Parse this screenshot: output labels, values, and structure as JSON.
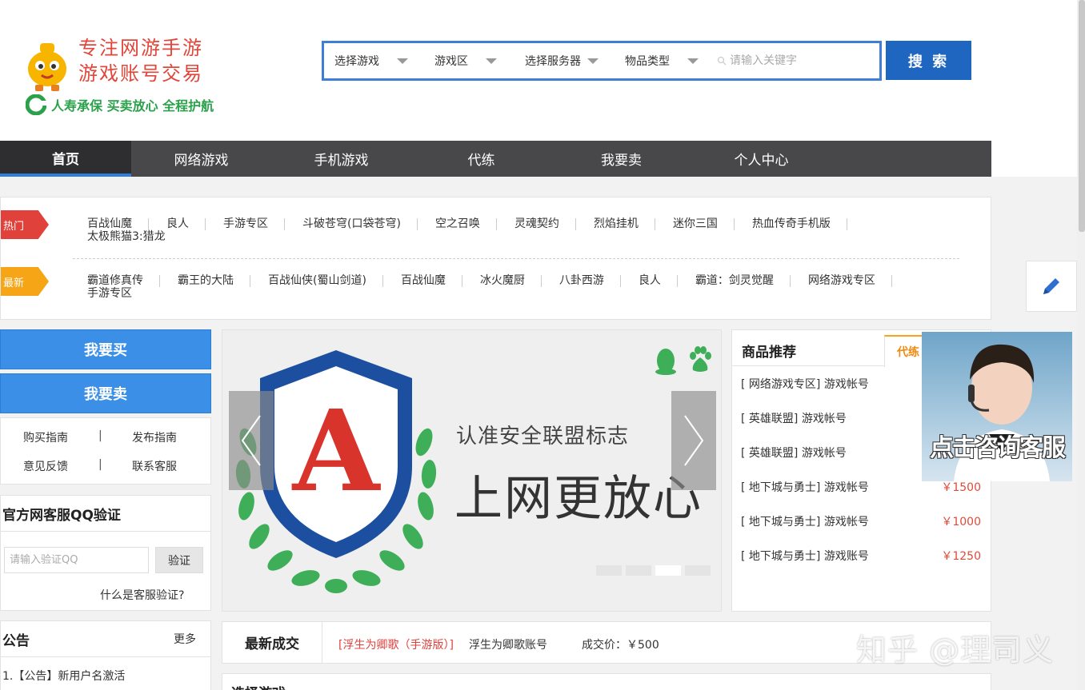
{
  "header": {
    "slogan_line1": "专注网游手游",
    "slogan_line2": "游戏账号交易",
    "promise": "人寿承保  买卖放心  全程护航"
  },
  "search": {
    "select_game": "选择游戏",
    "select_zone": "游戏区",
    "select_server": "选择服务器",
    "select_item_type": "物品类型",
    "keyword_placeholder": "请输入关键字",
    "button": "搜 索"
  },
  "nav": {
    "items": [
      {
        "label": "首页"
      },
      {
        "label": "网络游戏"
      },
      {
        "label": "手机游戏"
      },
      {
        "label": "代练"
      },
      {
        "label": "我要卖"
      },
      {
        "label": "个人中心"
      }
    ]
  },
  "hot": {
    "tag": "热门",
    "links": [
      "百战仙魔",
      "良人",
      "手游专区",
      "斗破苍穹(口袋苍穹)",
      "空之召唤",
      "灵魂契约",
      "烈焰挂机",
      "迷你三国",
      "热血传奇手机版",
      "太极熊猫3:猎龙"
    ]
  },
  "new": {
    "tag": "最新",
    "links": [
      "霸道修真传",
      "霸王的大陆",
      "百战仙侠(蜀山剑道)",
      "百战仙魔",
      "冰火魔厨",
      "八卦西游",
      "良人",
      "霸道：剑灵觉醒",
      "网络游戏专区",
      "手游专区"
    ]
  },
  "left": {
    "buy_button": "我要买",
    "sell_button": "我要卖",
    "guide_buy": "购买指南",
    "guide_publish": "发布指南",
    "feedback": "意见反馈",
    "contact": "联系客服",
    "separator": "|",
    "qq_title": "官方网客服QQ验证",
    "qq_placeholder": "请输入验证QQ",
    "qq_button": "验证",
    "qq_what": "什么是客服验证?",
    "notice_title": "公告",
    "notice_more": "更多",
    "notice_item": "1.【公告】新用户名激活"
  },
  "banner": {
    "line1": "认准安全联盟标志",
    "line2": "上网更放心",
    "shield_letter": "A",
    "active_dot": 2
  },
  "recommend": {
    "title": "商品推荐",
    "tab": "代练",
    "items": [
      {
        "name": "[ 网络游戏专区] 游戏帐号",
        "price": ""
      },
      {
        "name": "[ 英雄联盟] 游戏帐号",
        "price": ""
      },
      {
        "name": "[ 英雄联盟] 游戏帐号",
        "price": ""
      },
      {
        "name": "[ 地下城与勇士] 游戏帐号",
        "price": "￥1500"
      },
      {
        "name": "[ 地下城与勇士] 游戏帐号",
        "price": "￥1000"
      },
      {
        "name": "[ 地下城与勇士] 游戏账号",
        "price": "￥1250"
      }
    ]
  },
  "customer_service": {
    "text": "点击咨询客服"
  },
  "deal": {
    "title": "最新成交",
    "game": "[浮生为卿歌（手游版）]",
    "account": "浮生为卿歌账号",
    "price": "成交价：￥500"
  },
  "select_game_title": "选择游戏",
  "watermark": "知乎 @理司义",
  "colors": {
    "accent_blue": "#1f66c1",
    "nav_bg": "#48484a",
    "hot_red": "#e0413b",
    "new_orange": "#f5a516",
    "price_red": "#e04a3a"
  }
}
